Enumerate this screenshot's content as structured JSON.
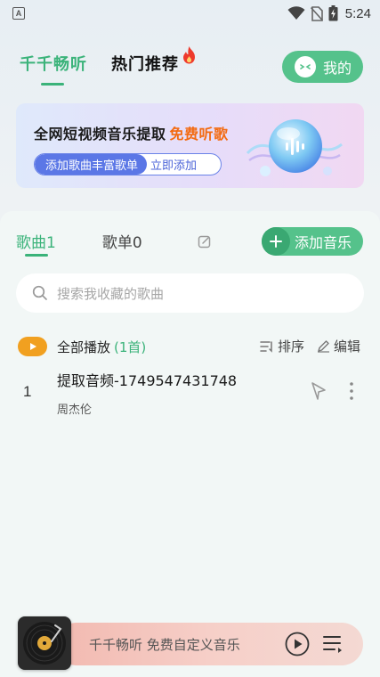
{
  "status_bar": {
    "time": "5:24",
    "app_icon": "A"
  },
  "top_tabs": {
    "active": "千千畅听",
    "hot": "热门推荐"
  },
  "mine_button": {
    "label": "我的"
  },
  "banner": {
    "title": "全网短视频音乐提取",
    "highlight": "免费听歌",
    "cta_left": "添加歌曲丰富歌单",
    "cta_right": "立即添加"
  },
  "sub_tabs": {
    "songs": "歌曲1",
    "playlists": "歌单0"
  },
  "add_music": {
    "label": "添加音乐"
  },
  "search": {
    "placeholder": "搜索我收藏的歌曲"
  },
  "play_all": {
    "label": "全部播放",
    "count": "(1首)"
  },
  "tools": {
    "sort": "排序",
    "edit": "编辑"
  },
  "songs": [
    {
      "index": "1",
      "title": "提取音频-1749547431748",
      "artist": "周杰伦"
    }
  ],
  "player": {
    "text": "千千畅听 免费自定义音乐"
  },
  "colors": {
    "accent": "#3bb37a",
    "button_green": "#55c28b",
    "highlight_orange": "#f36b12",
    "cta_blue": "#5b77e6"
  }
}
